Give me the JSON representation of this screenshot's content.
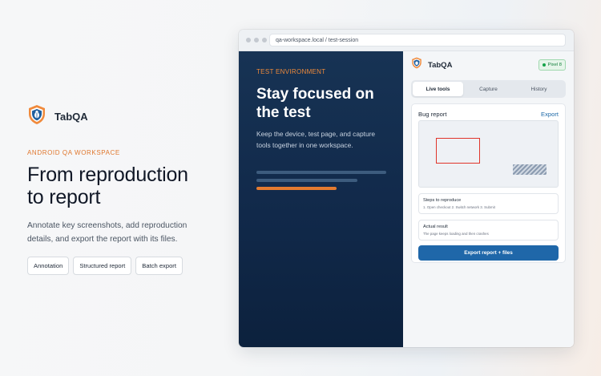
{
  "hero": {
    "brand_name": "TabQA",
    "eyebrow": "ANDROID QA WORKSPACE",
    "headline_line1": "From reproduction",
    "headline_line2": "to report",
    "description": "Annotate key screenshots, add reproduction details, and export the report with its files.",
    "tags": [
      "Annotation",
      "Structured report",
      "Batch export"
    ]
  },
  "browser": {
    "url": "qa-workspace.local / test-session"
  },
  "stage": {
    "label": "TEST ENVIRONMENT",
    "title_line1": "Stay focused on",
    "title_line2": "the test",
    "description": "Keep the device, test page, and capture tools together in one workspace."
  },
  "panel": {
    "app_name": "TabQA",
    "device_label": "Pixel 8",
    "tabs": [
      {
        "label": "Live tools",
        "active": true
      },
      {
        "label": "Capture",
        "active": false
      },
      {
        "label": "History",
        "active": false
      }
    ],
    "report": {
      "title": "Bug report",
      "export_link": "Export",
      "steps_label": "Steps to reproduce",
      "steps_value": "1. Open checkout   2. Switch network   3. Submit",
      "result_label": "Actual result",
      "result_value": "The page keeps loading and then crashes",
      "primary_button": "Export report + files"
    }
  },
  "colors": {
    "accent_orange": "#e47b30",
    "primary_blue": "#1f67a9",
    "stage_navy": "#12294a",
    "status_green": "#16a34a",
    "annotation_red": "#e0352b"
  },
  "icons": [
    "shield-bug-logo-icon",
    "browser-dot-icon",
    "status-led-icon"
  ]
}
